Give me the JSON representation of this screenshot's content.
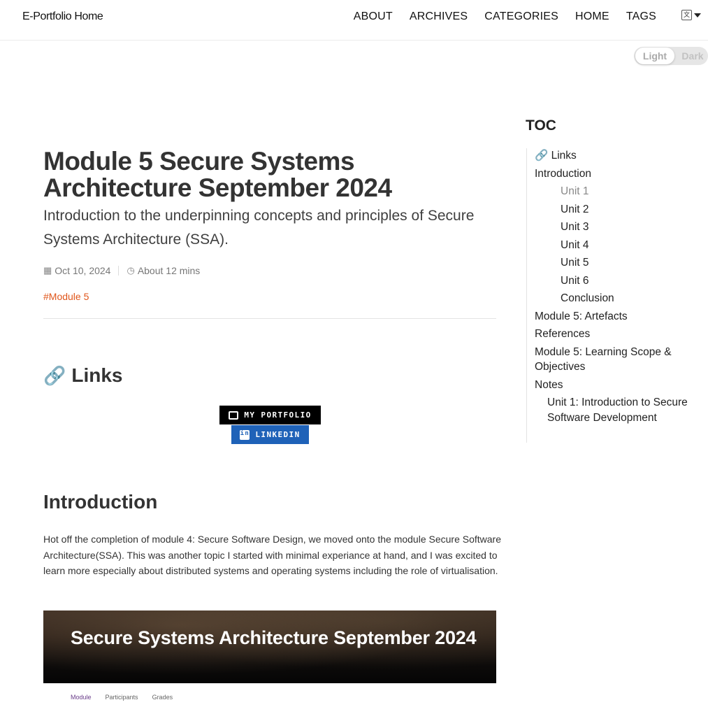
{
  "navbar": {
    "brand": "E-Portfolio Home",
    "links": [
      "ABOUT",
      "ARCHIVES",
      "CATEGORIES",
      "HOME",
      "TAGS"
    ],
    "lang_icon": "translate-icon"
  },
  "theme_toggle": {
    "light": "Light",
    "dark": "Dark",
    "selected": "Light"
  },
  "post": {
    "title": "Module 5 Secure Systems Architecture September 2024",
    "subtitle": "Introduction to the underpinning concepts and principles of Secure Systems Architecture (SSA).",
    "date": "Oct 10, 2024",
    "read_time": "About 12 mins",
    "tag": "#Module 5"
  },
  "links_section": {
    "heading": "Links",
    "badges": [
      "MY PORTFOLIO",
      "LINKEDIN"
    ]
  },
  "intro_section": {
    "heading": "Introduction",
    "text": "Hot off the completion of module 4: Secure Software Design, we moved onto the module Secure Software Architecture(SSA). This was another topic I started with minimal experiance at hand, and I was excited to learn more especially about distributed systems and operating systems including the role of virtualisation.",
    "banner_title": "Secure Systems Architecture September 2024",
    "subnav": [
      "Module",
      "Participants",
      "Grades"
    ]
  },
  "toc": {
    "heading": "TOC",
    "items": [
      {
        "label": "🔗 Links",
        "level": 1
      },
      {
        "label": "Introduction",
        "level": 1
      },
      {
        "label": "Unit 1",
        "level": 2,
        "active": true
      },
      {
        "label": "Unit 2",
        "level": 2
      },
      {
        "label": "Unit 3",
        "level": 2
      },
      {
        "label": "Unit 4",
        "level": 2
      },
      {
        "label": "Unit 5",
        "level": 2
      },
      {
        "label": "Unit 6",
        "level": 2
      },
      {
        "label": "Conclusion",
        "level": 2
      },
      {
        "label": "Module 5: Artefacts",
        "level": 1
      },
      {
        "label": "References",
        "level": 1
      },
      {
        "label": "Module 5: Learning Scope & Objectives",
        "level": 1
      },
      {
        "label": "Notes",
        "level": 1
      },
      {
        "label": "Unit 1: Introduction to Secure Software Development",
        "level": 2
      }
    ]
  },
  "colors": {
    "tag": "#e0561b",
    "linkedin": "#1f62b8",
    "portfolio_badge": "#000000"
  }
}
